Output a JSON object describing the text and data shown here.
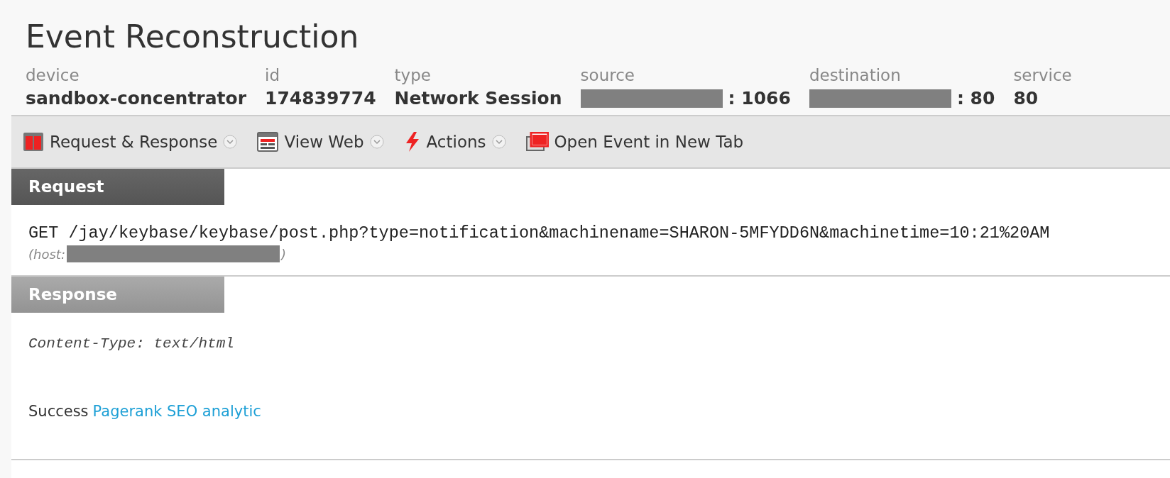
{
  "title": "Event Reconstruction",
  "fields": [
    {
      "label": "device",
      "value": "sandbox-concentrator",
      "redacted": false
    },
    {
      "label": "id",
      "value": "174839774",
      "redacted": false
    },
    {
      "label": "type",
      "value": "Network Session",
      "redacted": false
    },
    {
      "label": "source",
      "value": ": 1066",
      "redacted": true
    },
    {
      "label": "destination",
      "value": ": 80",
      "redacted": true
    },
    {
      "label": "service",
      "value": "80",
      "redacted": false
    }
  ],
  "toolbar": [
    {
      "label": "Request & Response",
      "kind": "split",
      "dropdown": true
    },
    {
      "label": "View Web",
      "kind": "web",
      "dropdown": true
    },
    {
      "label": "Actions",
      "kind": "bolt",
      "dropdown": true
    },
    {
      "label": "Open Event in New Tab",
      "kind": "window",
      "dropdown": false
    }
  ],
  "request": {
    "heading": "Request",
    "line": "GET /jay/keybase/keybase/post.php?type=notification&machinename=SHARON-5MFYDD6N&machinetime=10:21%20AM",
    "host_prefix": "(host:",
    "host_suffix": ")"
  },
  "response": {
    "heading": "Response",
    "header": "Content-Type: text/html",
    "body_text": "Success",
    "body_link": "Pagerank SEO analytic"
  }
}
